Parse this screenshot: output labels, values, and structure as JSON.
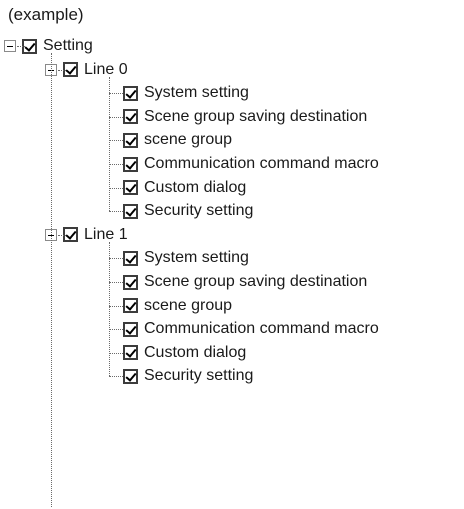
{
  "caption": "(example)",
  "tree": {
    "label": "Setting",
    "expanded": true,
    "checked": true,
    "children": [
      {
        "label": "Line 0",
        "expanded": true,
        "checked": true,
        "children": [
          {
            "label": "System setting",
            "checked": true
          },
          {
            "label": "Scene group saving destination",
            "checked": true
          },
          {
            "label": "scene group",
            "checked": true
          },
          {
            "label": "Communication command macro",
            "checked": true
          },
          {
            "label": "Custom dialog",
            "checked": true
          },
          {
            "label": "Security setting",
            "checked": true
          }
        ]
      },
      {
        "label": "Line 1",
        "expanded": true,
        "checked": true,
        "children": [
          {
            "label": "System setting",
            "checked": true
          },
          {
            "label": "Scene group saving destination",
            "checked": true
          },
          {
            "label": "scene group",
            "checked": true
          },
          {
            "label": "Communication command macro",
            "checked": true
          },
          {
            "label": "Custom dialog",
            "checked": true
          },
          {
            "label": "Security setting",
            "checked": true
          }
        ]
      }
    ]
  }
}
